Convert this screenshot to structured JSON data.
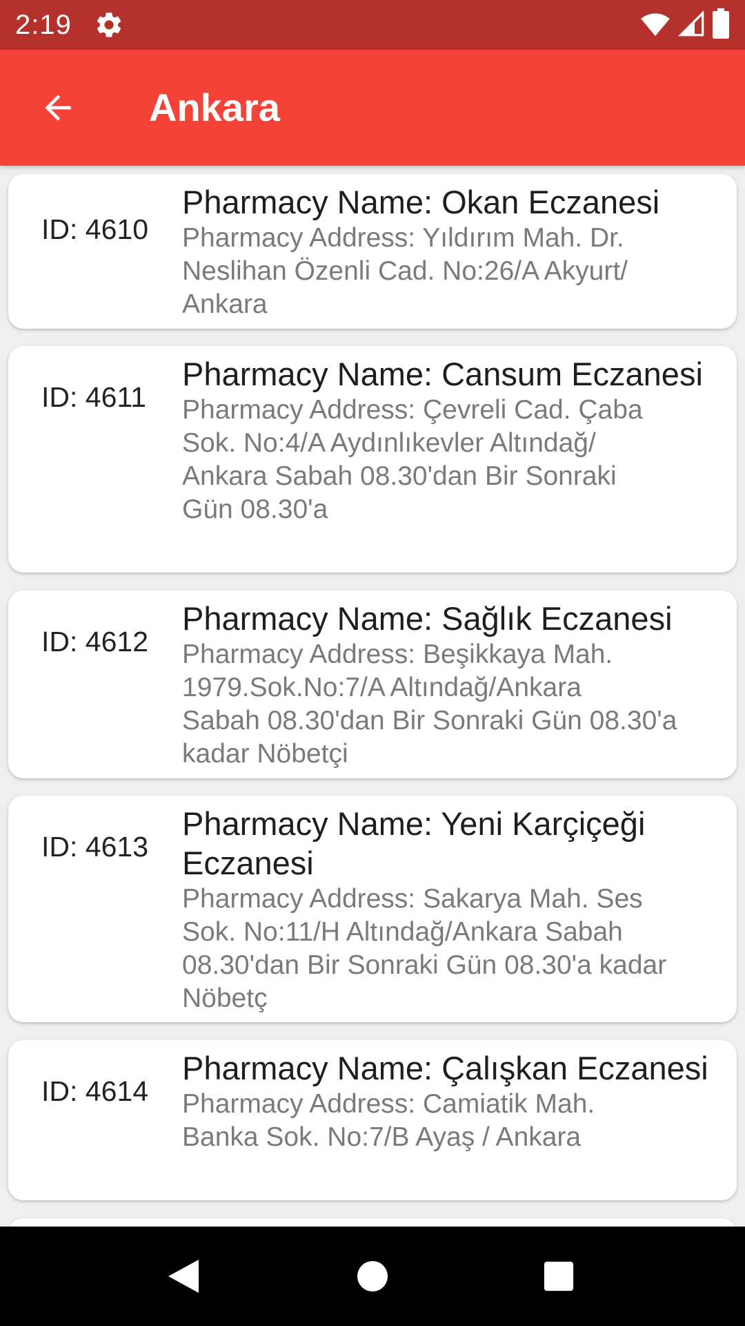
{
  "status_bar": {
    "time": "2:19",
    "icons": [
      "settings-gear-icon",
      "wifi-icon",
      "cellular-signal-icon",
      "battery-icon"
    ]
  },
  "app_bar": {
    "title": "Ankara",
    "back_icon": "arrow-left-icon",
    "color": "#f44336"
  },
  "pharmacies": [
    {
      "id_label": "ID: 4610",
      "name": "Pharmacy Name: Okan Eczanesi",
      "address_lines": [
        "Pharmacy Address: Yıldırım Mah. Dr.",
        "Neslihan Özenli Cad. No:26/A Akyurt/",
        "Ankara"
      ]
    },
    {
      "id_label": "ID: 4611",
      "name": "Pharmacy Name: Cansum Eczanesi",
      "address_lines": [
        "Pharmacy Address: Çevreli Cad. Çaba",
        "Sok. No:4/A Aydınlıkevler Altındağ/",
        "Ankara  Sabah 08.30'dan Bir Sonraki",
        "Gün 08.30'a"
      ]
    },
    {
      "id_label": "ID: 4612",
      "name": "Pharmacy Name: Sağlık Eczanesi",
      "address_lines": [
        "Pharmacy Address: Beşikkaya Mah.",
        "1979.Sok.No:7/A Altındağ/Ankara",
        "Sabah 08.30'dan Bir Sonraki Gün 08.30'a",
        "kadar Nöbetçi"
      ]
    },
    {
      "id_label": "ID: 4613",
      "name": "Pharmacy Name: Yeni Karçiçeği Eczanesi",
      "address_lines": [
        "Pharmacy Address: Sakarya Mah. Ses",
        "Sok. No:11/H  Altındağ/Ankara  Sabah",
        "08.30'dan Bir Sonraki Gün 08.30'a kadar",
        "Nöbetç"
      ]
    },
    {
      "id_label": "ID: 4614",
      "name": "Pharmacy Name: Çalışkan Eczanesi",
      "address_lines": [
        "Pharmacy Address: Camiatik Mah.",
        "Banka Sok. No:7/B Ayaş / Ankara"
      ]
    }
  ],
  "nav_bar": {
    "icons": [
      "back-triangle-icon",
      "home-circle-icon",
      "recents-square-icon"
    ]
  }
}
